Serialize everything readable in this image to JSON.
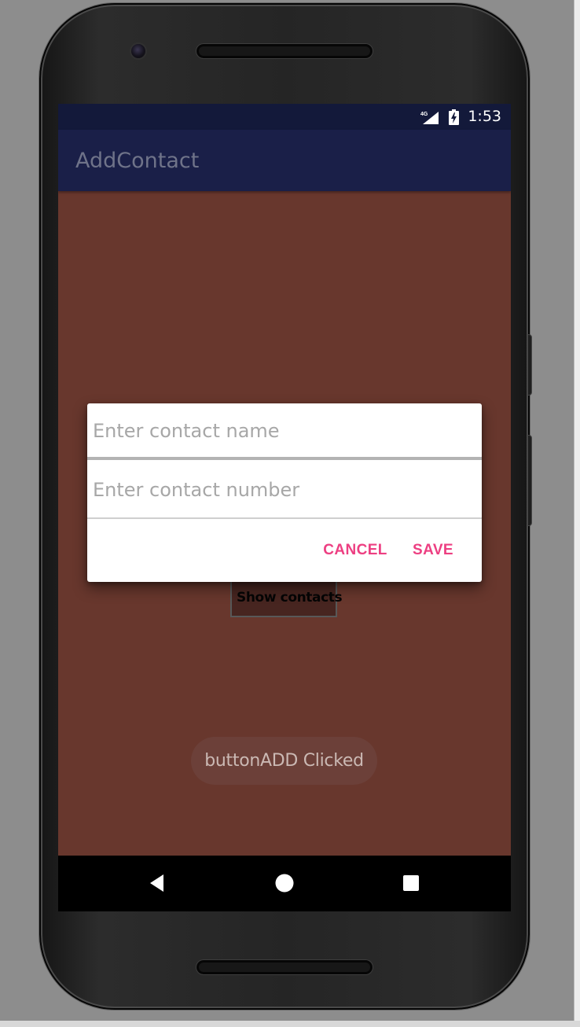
{
  "status_bar": {
    "network_type": "4G",
    "time": "1:53",
    "icons": {
      "signal": "mobile-signal-icon",
      "battery": "battery-charging-icon"
    }
  },
  "app_bar": {
    "title": "AddContact"
  },
  "main": {
    "show_contacts_label": "Show contacts"
  },
  "dialog": {
    "name_field": {
      "value": "",
      "placeholder": "Enter contact name"
    },
    "number_field": {
      "value": "",
      "placeholder": "Enter contact number"
    },
    "cancel_label": "CANCEL",
    "save_label": "SAVE"
  },
  "toast": {
    "message": "buttonADD Clicked"
  },
  "navigation": {
    "icons": [
      "back-icon",
      "home-icon",
      "recents-icon"
    ]
  },
  "colors": {
    "background": "#68372d",
    "status_bar": "#13193a",
    "app_bar": "#1a1f48",
    "title_text": "#6f7389",
    "dialog_background": "#ffffff",
    "dialog_accent": "#ed3f82",
    "placeholder_text": "#a7a7a7",
    "toast_background": "#6c4039",
    "toast_text": "#cbb9b4",
    "navigation_bar": "#000000"
  }
}
